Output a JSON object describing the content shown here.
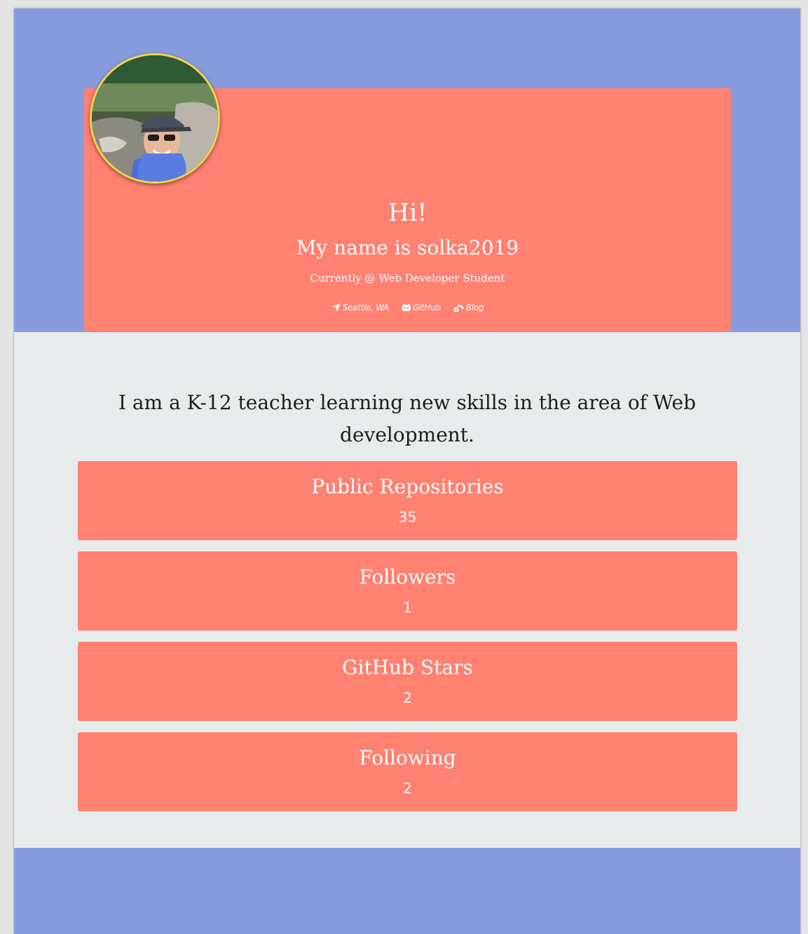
{
  "colors": {
    "header_background": "#879cde",
    "card_background": "#ff8171",
    "body_background": "#e8ebec",
    "avatar_border": "#f2d54a"
  },
  "profile": {
    "greeting": "Hi!",
    "name_line": "My name is solka2019",
    "job_line": "Currently @ Web Developer Student",
    "avatar_icon": "profile-photo",
    "links": [
      {
        "icon": "location-arrow-icon",
        "label": "Seattle, WA"
      },
      {
        "icon": "github-icon",
        "label": "GitHub"
      },
      {
        "icon": "blog-icon",
        "label": "Blog"
      }
    ]
  },
  "bio": "I am a K-12 teacher learning new skills in the area of Web development.",
  "stats": [
    {
      "label": "Public Repositories",
      "value": "35"
    },
    {
      "label": "Followers",
      "value": "1"
    },
    {
      "label": "GitHub Stars",
      "value": "2"
    },
    {
      "label": "Following",
      "value": "2"
    }
  ]
}
